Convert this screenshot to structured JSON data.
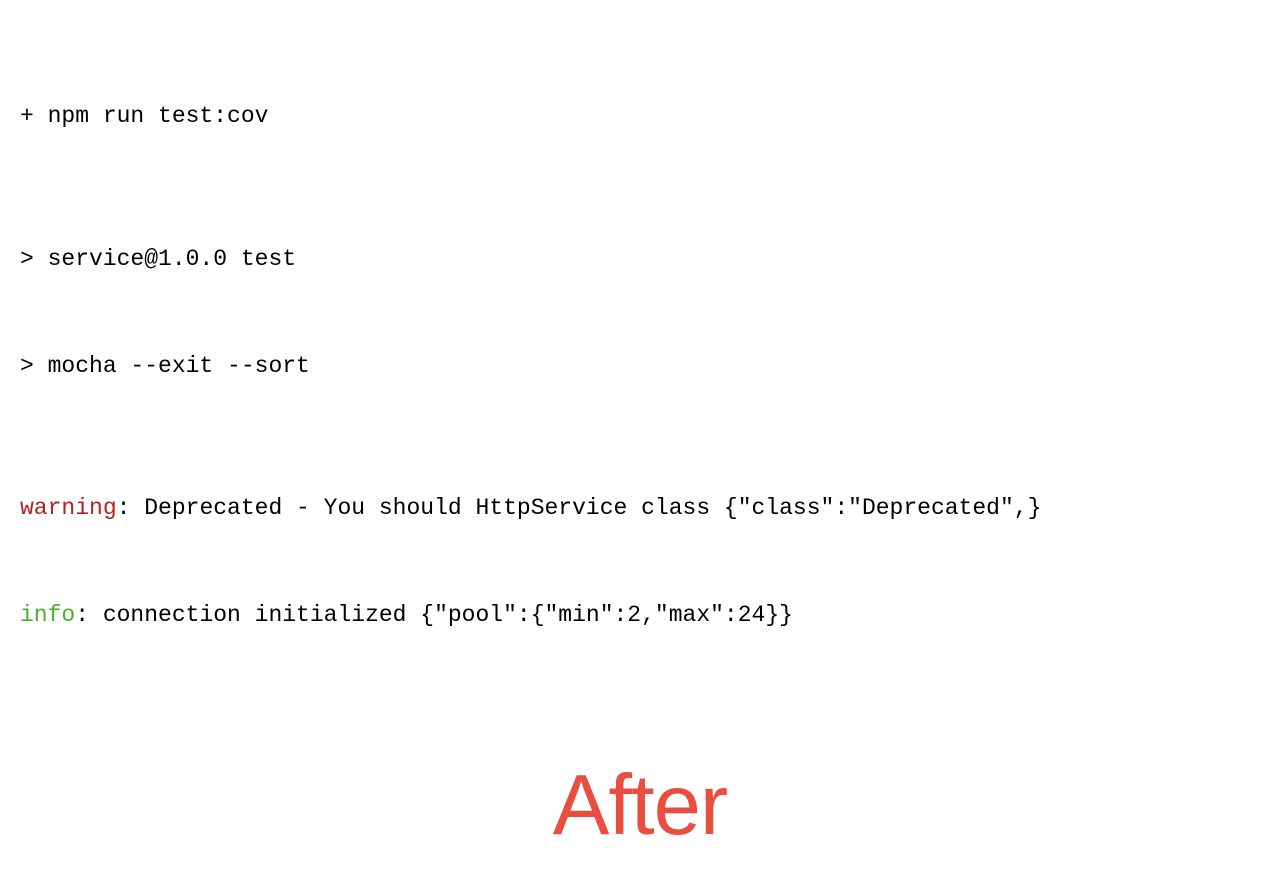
{
  "terminal": {
    "line1": "+ npm run test:cov",
    "line2": "> service@1.0.0 test",
    "line3": "> mocha --exit --sort",
    "warning_tag": "warning",
    "warning_rest": ": Deprecated - You should HttpService class {\"class\":\"Deprecated\",}",
    "info_tag": "info",
    "info_rest": ": connection initialized {\"pool\":{\"min\":2,\"max\":24}}"
  },
  "label": {
    "after": "After"
  },
  "colors": {
    "warning": "#b22222",
    "info": "#4caf2f",
    "after": "#e94e3e"
  }
}
